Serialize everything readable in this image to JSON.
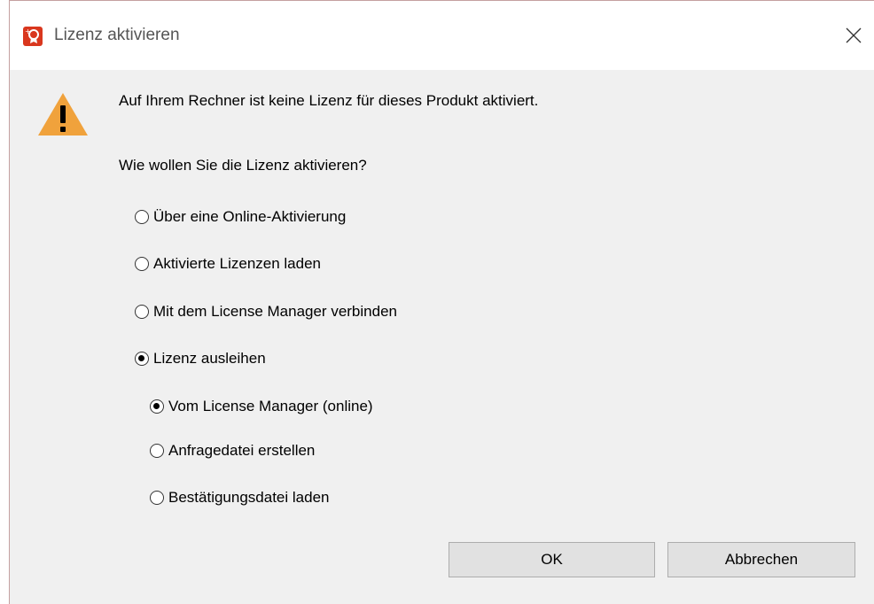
{
  "window": {
    "title": "Lizenz aktivieren",
    "app_icon": "license-ribbon-icon",
    "close_icon": "close-icon"
  },
  "message": {
    "icon": "warning-icon",
    "text": "Auf Ihrem Rechner ist keine Lizenz für dieses Produkt aktiviert."
  },
  "question": "Wie wollen Sie die Lizenz aktivieren?",
  "options": [
    {
      "label": "Über eine Online-Aktivierung",
      "checked": false
    },
    {
      "label": "Aktivierte Lizenzen laden",
      "checked": false
    },
    {
      "label": "Mit dem License Manager verbinden",
      "checked": false
    },
    {
      "label": "Lizenz ausleihen",
      "checked": true
    }
  ],
  "sub_options": [
    {
      "label": "Vom License Manager (online)",
      "checked": true
    },
    {
      "label": "Anfragedatei erstellen",
      "checked": false
    },
    {
      "label": "Bestätigungsdatei laden",
      "checked": false
    }
  ],
  "buttons": {
    "ok": "OK",
    "cancel": "Abbrechen"
  },
  "colors": {
    "accent_icon": "#d9371e",
    "warning": "#f0a23c"
  }
}
